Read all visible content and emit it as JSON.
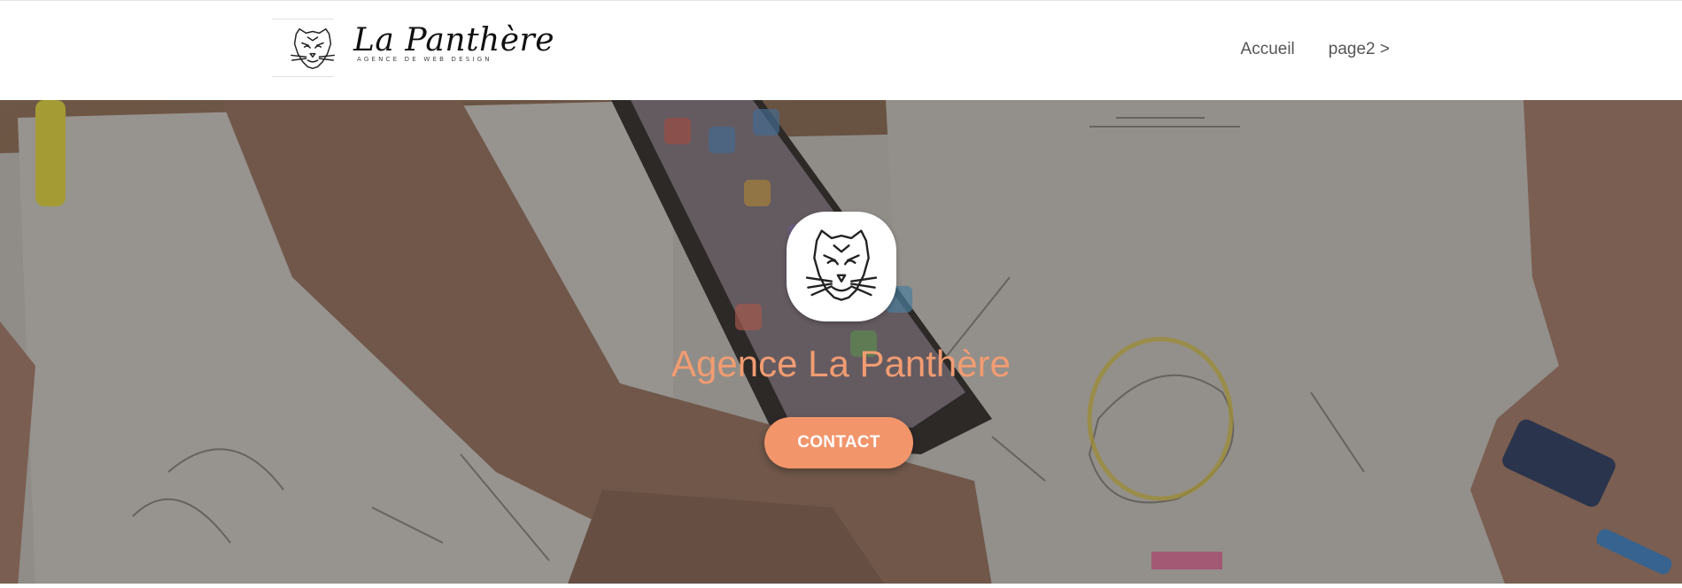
{
  "header": {
    "logo_title": "La Panthère",
    "logo_subtitle": "AGENCE DE WEB DESIGN",
    "nav": [
      {
        "label": "Accueil"
      },
      {
        "label": "page2 >"
      }
    ]
  },
  "hero": {
    "title": "Agence La Panthère",
    "cta_label": "CONTACT"
  },
  "colors": {
    "accent": "#f2956b",
    "title": "#f29c72",
    "nav_text": "#555555",
    "hero_tint": "#7d7773"
  },
  "icons": {
    "logo": "panther-head-icon",
    "hero_avatar": "panther-head-icon"
  }
}
